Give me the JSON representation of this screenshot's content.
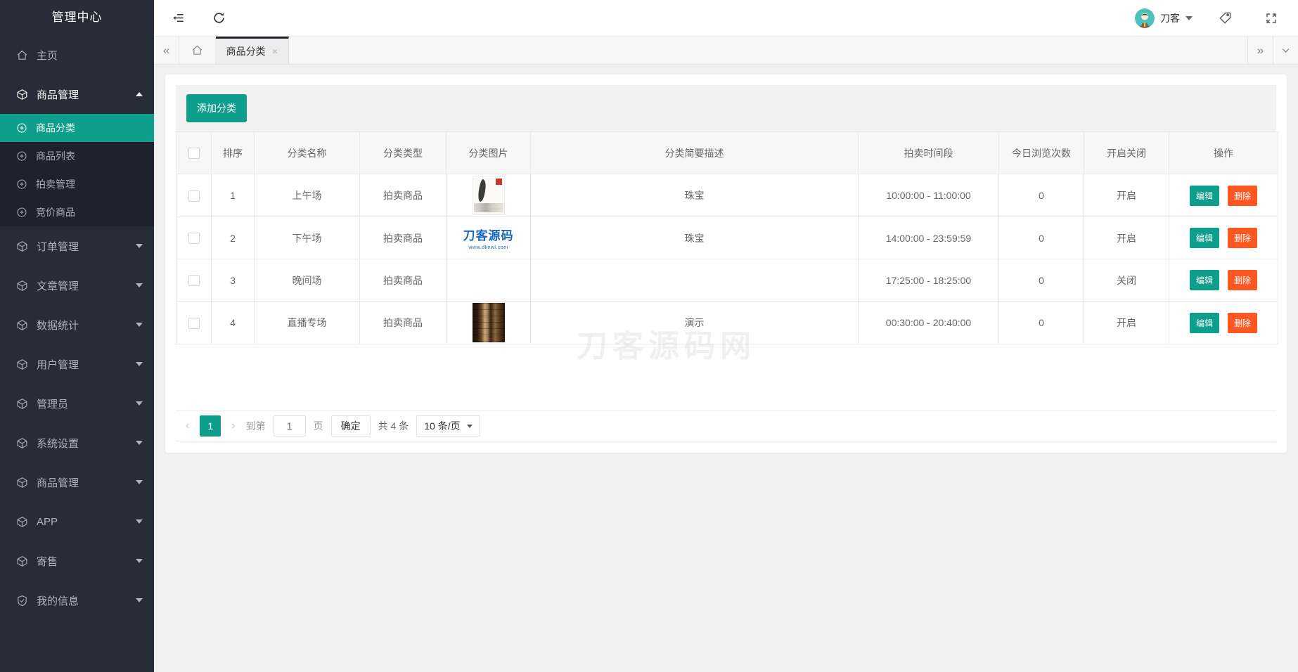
{
  "sidebar": {
    "title": "管理中心",
    "home": "主页",
    "group_expanded": "商品管理",
    "submenu": [
      "商品分类",
      "商品列表",
      "拍卖管理",
      "竞价商品"
    ],
    "groups": [
      "订单管理",
      "文章管理",
      "数据统计",
      "用户管理",
      "管理员",
      "系统设置",
      "商品管理",
      "APP",
      "寄售",
      "我的信息"
    ]
  },
  "header": {
    "username": "刀客"
  },
  "tabs": {
    "active_label": "商品分类",
    "close": "×",
    "prev": "«",
    "next": "»"
  },
  "toolbar": {
    "add_label": "添加分类"
  },
  "table": {
    "columns": {
      "sort": "排序",
      "name": "分类名称",
      "type": "分类类型",
      "image": "分类图片",
      "desc": "分类简要描述",
      "time": "拍卖时间段",
      "views": "今日浏览次数",
      "status": "开启关闭",
      "actions": "操作"
    },
    "rows": [
      {
        "sort": "1",
        "name": "上午场",
        "type": "拍卖商品",
        "desc": "珠宝",
        "time": "10:00:00  -  11:00:00",
        "views": "0",
        "status": "开启"
      },
      {
        "sort": "2",
        "name": "下午场",
        "type": "拍卖商品",
        "logo_text": "刀客源码",
        "logo_sub": "www.dkewl.com",
        "desc": "珠宝",
        "time": "14:00:00  -  23:59:59",
        "views": "0",
        "status": "开启"
      },
      {
        "sort": "3",
        "name": "晚间场",
        "type": "拍卖商品",
        "desc": "",
        "time": "17:25:00  -  18:25:00",
        "views": "0",
        "status": "关闭"
      },
      {
        "sort": "4",
        "name": "直播专场",
        "type": "拍卖商品",
        "desc": "演示",
        "time": "00:30:00  -  20:40:00",
        "views": "0",
        "status": "开启"
      }
    ],
    "actions": {
      "edit": "编辑",
      "delete": "删除"
    }
  },
  "pagination": {
    "prev": "‹",
    "page": "1",
    "next": "›",
    "goto_prefix": "到第",
    "goto_value": "1",
    "goto_suffix": "页",
    "confirm": "确定",
    "total": "共 4 条",
    "per_page": "10 条/页"
  },
  "watermark": "刀客源码网",
  "colors": {
    "accent": "#0d9e8c",
    "danger": "#ff5722",
    "sidebar": "#272d38"
  }
}
